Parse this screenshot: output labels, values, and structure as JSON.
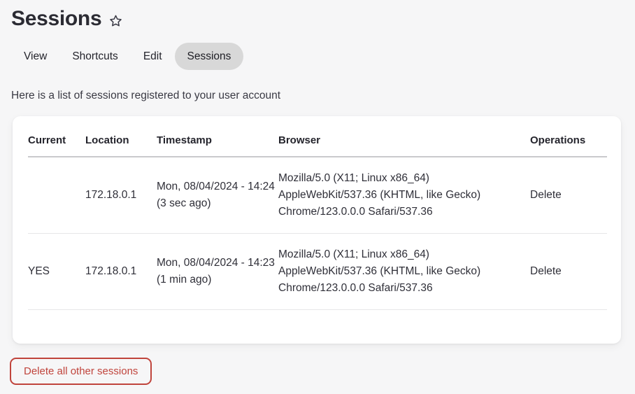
{
  "header": {
    "title": "Sessions",
    "favorite_icon": "star-outline-icon"
  },
  "tabs": [
    {
      "label": "View",
      "active": false
    },
    {
      "label": "Shortcuts",
      "active": false
    },
    {
      "label": "Edit",
      "active": false
    },
    {
      "label": "Sessions",
      "active": true
    }
  ],
  "description": "Here is a list of sessions registered to your user account",
  "table": {
    "columns": [
      "Current",
      "Location",
      "Timestamp",
      "Browser",
      "Operations"
    ],
    "rows": [
      {
        "current": "",
        "location": "172.18.0.1",
        "timestamp": "Mon, 08/04/2024 - 14:24 (3 sec ago)",
        "browser": "Mozilla/5.0 (X11; Linux x86_64) AppleWebKit/537.36 (KHTML, like Gecko) Chrome/123.0.0.0 Safari/537.36",
        "operation": "Delete"
      },
      {
        "current": "YES",
        "location": "172.18.0.1",
        "timestamp": "Mon, 08/04/2024 - 14:23 (1 min ago)",
        "browser": "Mozilla/5.0 (X11; Linux x86_64) AppleWebKit/537.36 (KHTML, like Gecko) Chrome/123.0.0.0 Safari/537.36",
        "operation": "Delete"
      }
    ]
  },
  "actions": {
    "delete_all_label": "Delete all other sessions",
    "danger_color": "#c0443c"
  },
  "colors": {
    "page_background": "#f6f6f7",
    "card_background": "#ffffff",
    "text": "#2c2c35",
    "active_tab_background": "#d8d8d8"
  }
}
